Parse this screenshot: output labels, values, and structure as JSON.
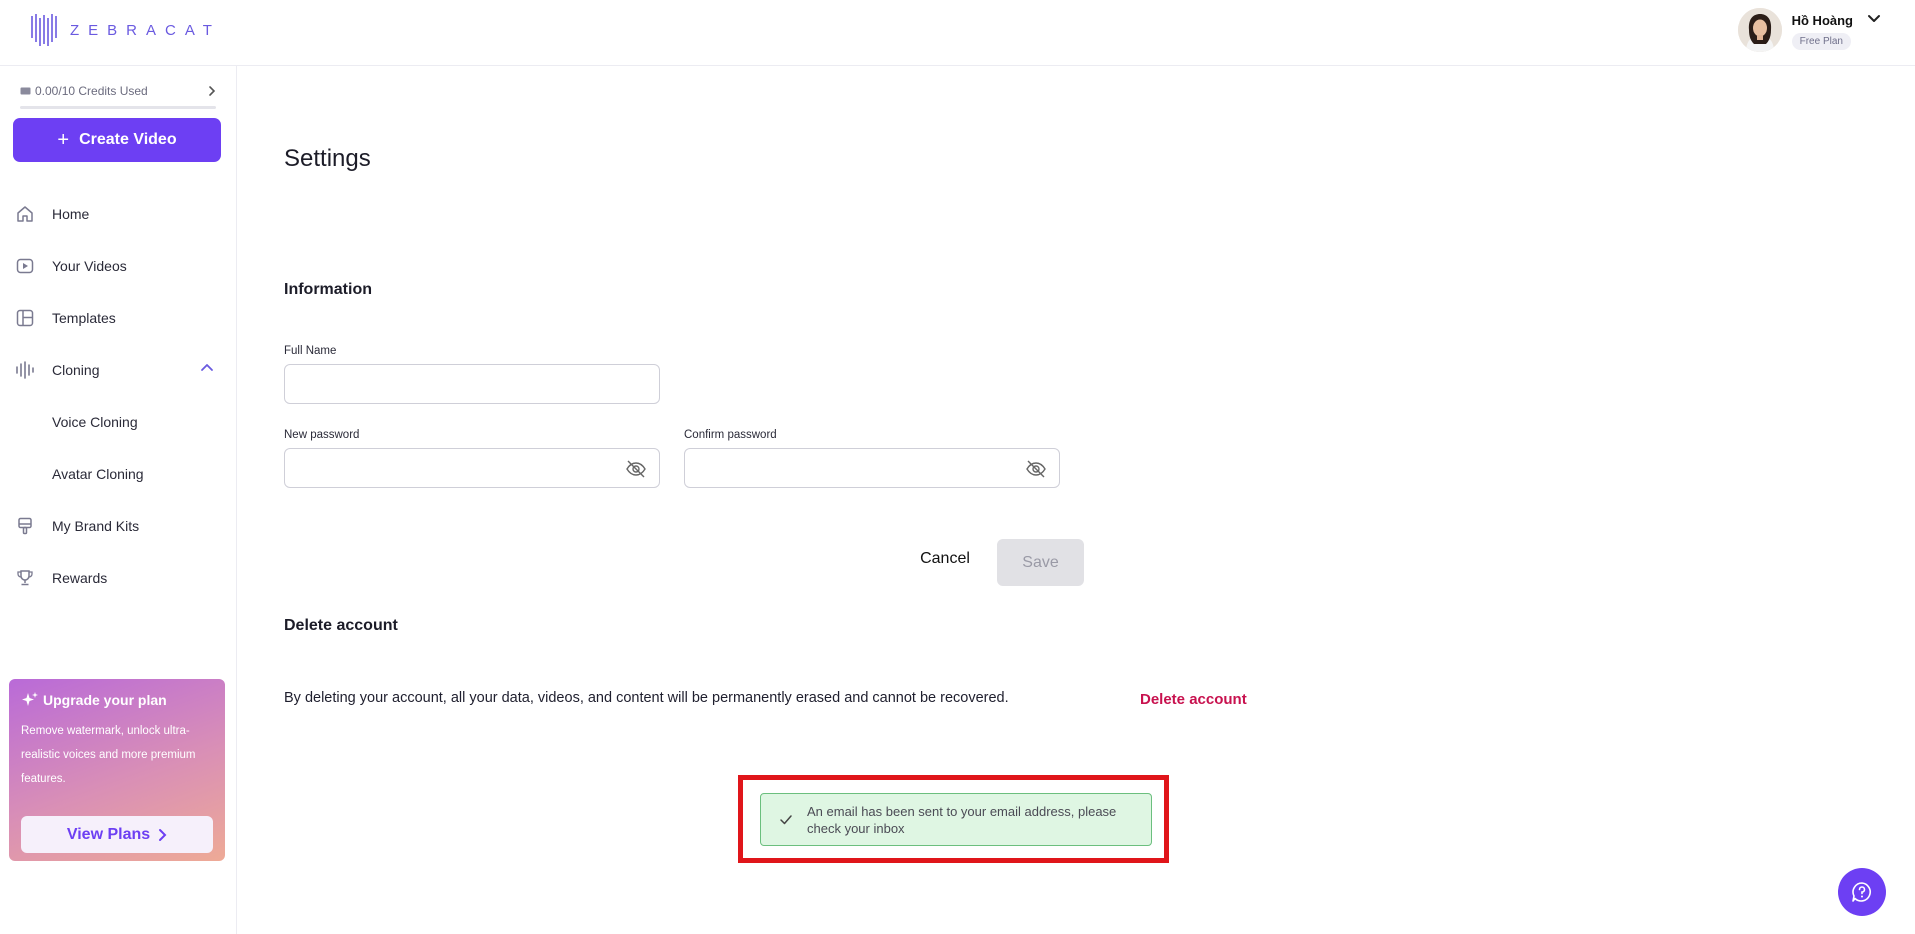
{
  "brand": {
    "name": "ZEBRACAT",
    "accent": "#6d3ff3"
  },
  "user": {
    "name": "Hồ Hoàng",
    "plan": "Free Plan"
  },
  "sidebar": {
    "credits_label": "0.00/10 Credits Used",
    "credits_used": 0,
    "credits_total": 10,
    "create_label": "Create Video",
    "items": [
      {
        "label": "Home",
        "icon": "home-icon"
      },
      {
        "label": "Your Videos",
        "icon": "video-icon"
      },
      {
        "label": "Templates",
        "icon": "templates-icon"
      },
      {
        "label": "Cloning",
        "icon": "waveform-icon"
      },
      {
        "label": "Voice Cloning"
      },
      {
        "label": "Avatar Cloning"
      },
      {
        "label": "My Brand Kits",
        "icon": "brush-icon"
      },
      {
        "label": "Rewards",
        "icon": "trophy-icon"
      }
    ],
    "upgrade": {
      "title": "Upgrade your plan",
      "text": "Remove watermark, unlock ultra-realistic voices and more premium features.",
      "button": "View Plans"
    }
  },
  "settings": {
    "title": "Settings",
    "information_title": "Information",
    "full_name_label": "Full Name",
    "full_name_value": "",
    "new_password_label": "New password",
    "confirm_password_label": "Confirm password",
    "cancel_label": "Cancel",
    "save_label": "Save",
    "delete_title": "Delete account",
    "delete_description": "By deleting your account, all your data, videos, and content will be permanently erased and cannot be recovered.",
    "delete_link": "Delete account"
  },
  "toast": {
    "message": "An email has been sent to your email address, please check your inbox",
    "status_color": "#dff6e3"
  },
  "highlight_color": "#e0151a"
}
